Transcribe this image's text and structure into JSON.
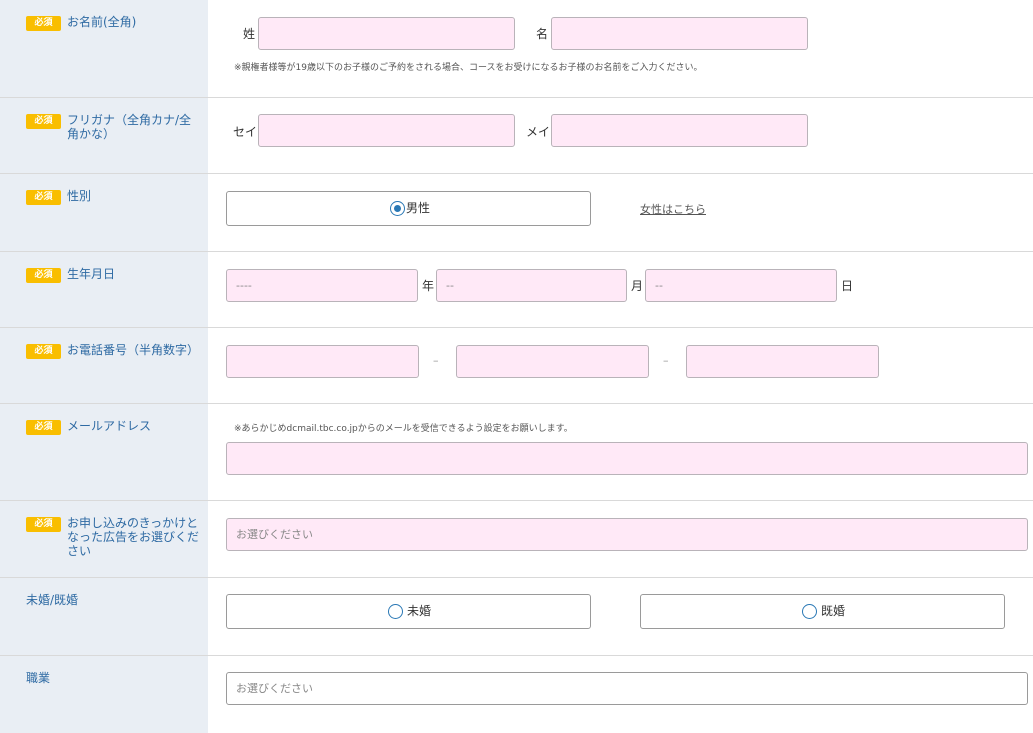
{
  "required_label": "必須",
  "name": {
    "label": "お名前(全角)",
    "sei_label": "姓",
    "mei_label": "名",
    "note": "※親権者様等が19歳以下のお子様のご予約をされる場合、コースをお受けになるお子様のお名前をご入力ください。"
  },
  "furigana": {
    "label": "フリガナ（全角カナ/全角かな）",
    "sei_label": "セイ",
    "mei_label": "メイ"
  },
  "gender": {
    "label": "性別",
    "option": "男性",
    "link": "女性はこちら"
  },
  "birthday": {
    "label": "生年月日",
    "year_placeholder": "----",
    "month_placeholder": "--",
    "day_placeholder": "--",
    "year_unit": "年",
    "month_unit": "月",
    "day_unit": "日"
  },
  "phone": {
    "label": "お電話番号（半角数字）",
    "separator": "–"
  },
  "email": {
    "label": "メールアドレス",
    "note": "※あらかじめdcmail.tbc.co.jpからのメールを受信できるよう設定をお願いします。"
  },
  "ad": {
    "label": "お申し込みのきっかけとなった広告をお選びください",
    "placeholder": "お選びください"
  },
  "marital": {
    "label": "未婚/既婚",
    "single": "未婚",
    "married": "既婚"
  },
  "job": {
    "label": "職業",
    "placeholder": "お選びください"
  },
  "colors": {
    "label_bg": "#e9eef4",
    "badge": "#f9be00",
    "input_bg": "#ffe9f7",
    "label_text": "#2e6aa3",
    "radio": "#2a78b5"
  }
}
